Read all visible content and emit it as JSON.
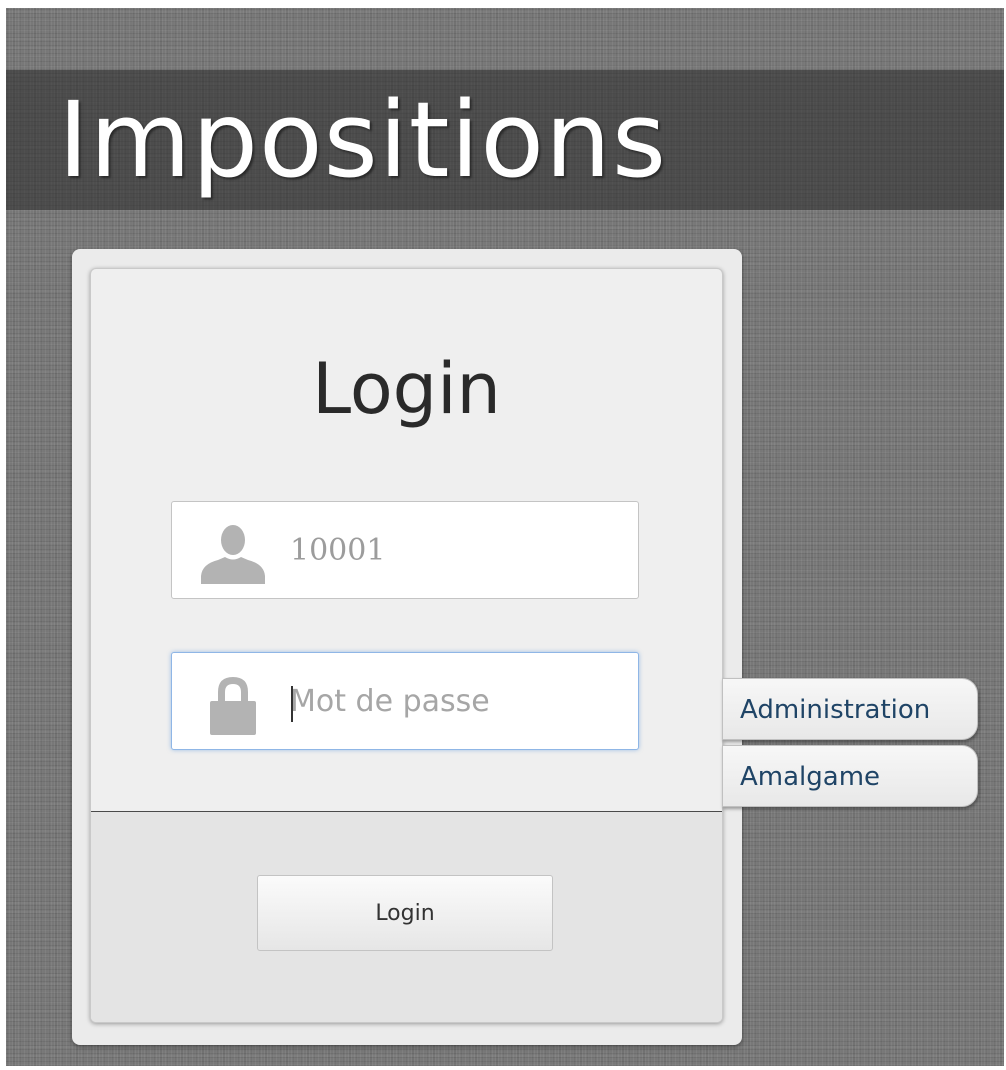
{
  "app": {
    "title": "Impositions"
  },
  "login": {
    "title": "Login",
    "username": {
      "value": "10001",
      "icon": "user-icon"
    },
    "password": {
      "placeholder": "Mot de passe",
      "icon": "lock-icon",
      "focused": true
    },
    "submit_label": "Login"
  },
  "side_tabs": [
    {
      "label": "Administration"
    },
    {
      "label": "Amalgame"
    }
  ],
  "colors": {
    "background": "#787878",
    "title_text": "#ffffff",
    "card": "#efefef",
    "tab_text": "#1f4466",
    "focus_ring": "#8fb6e6",
    "icon": "#b3b3b3"
  }
}
